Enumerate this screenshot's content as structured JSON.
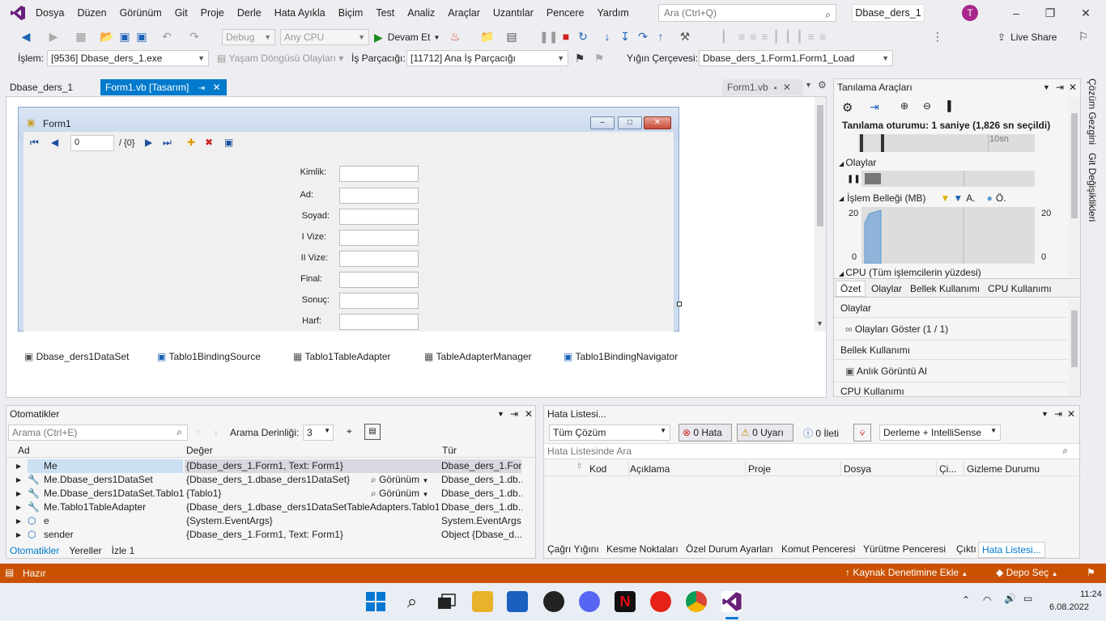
{
  "menubar": {
    "menus": [
      "Dosya",
      "Düzen",
      "Görünüm",
      "Git",
      "Proje",
      "Derle",
      "Hata Ayıkla",
      "Biçim",
      "Test",
      "Analiz",
      "Araçlar",
      "Uzantılar",
      "Pencere",
      "Yardım"
    ],
    "search_placeholder": "Ara (Ctrl+Q)",
    "solution_name": "Dbase_ders_1",
    "avatar_letter": "T",
    "brand_color": "#68217a"
  },
  "toolbar": {
    "config": "Debug",
    "platform": "Any CPU",
    "continue_label": "Devam Et",
    "live_share": "Live Share"
  },
  "debugbar": {
    "process_label": "İşlem:",
    "process_value": "[9536] Dbase_ders_1.exe",
    "lifecycle_label": "Yaşam Döngüsü Olayları",
    "thread_label": "İş Parçacığı:",
    "thread_value": "[11712] Ana İş Parçacığı",
    "stack_label": "Yığın Çerçevesi:",
    "stack_value": "Dbase_ders_1.Form1.Form1_Load"
  },
  "doctabs": {
    "tab1": "Dbase_ders_1",
    "tab2": "Form1.vb [Tasarım]",
    "right_tab": "Form1.vb"
  },
  "form": {
    "title": "Form1",
    "nav_position": "0",
    "nav_count": "/ {0}",
    "fields": [
      "Kimlik:",
      "Ad:",
      "Soyad:",
      "I Vize:",
      "II Vize:",
      "Final:",
      "Sonuç:",
      "Harf:"
    ]
  },
  "tray": {
    "items": [
      "Dbase_ders1DataSet",
      "Tablo1BindingSource",
      "Tablo1TableAdapter",
      "TableAdapterManager",
      "Tablo1BindingNavigator"
    ]
  },
  "diagnostics": {
    "title": "Tanılama Araçları",
    "session": "Tanılama oturumu: 1 saniye (1,826 sn seçildi)",
    "timeline_tick": "10sn",
    "events_label": "Olaylar",
    "memory_label": "İşlem Belleği (MB)",
    "memory_legend_a": "A.",
    "memory_legend_o": "Ö.",
    "memory_max_left": "20",
    "memory_min_left": "0",
    "memory_max_right": "20",
    "memory_min_right": "0",
    "cpu_label": "CPU (Tüm işlemcilerin yüzdesi)",
    "tabs": [
      "Özet",
      "Olaylar",
      "Bellek Kullanımı",
      "CPU Kullanımı"
    ],
    "sec_events": "Olaylar",
    "show_events": "Olayları Göster (1 / 1)",
    "sec_memory": "Bellek Kullanımı",
    "snapshot": "Anlık Görüntü Al",
    "sec_cpu": "CPU Kullanımı"
  },
  "sidebar": {
    "solution_explorer": "Çözüm Gezgini",
    "git_changes": "Git Değişiklikleri"
  },
  "autos": {
    "title": "Otomatikler",
    "search_placeholder": "Arama (Ctrl+E)",
    "depth_label": "Arama Derinliği:",
    "depth_value": "3",
    "columns": [
      "Ad",
      "Değer",
      "Tür"
    ],
    "view_label": "Görünüm",
    "rows": [
      {
        "name": "Me",
        "value": "{Dbase_ders_1.Form1, Text: Form1}",
        "type": "Dbase_ders_1.For..."
      },
      {
        "name": "Me.Dbase_ders1DataSet",
        "value": "{Dbase_ders_1.dbase_ders1DataSet}",
        "type": "Dbase_ders_1.db..."
      },
      {
        "name": "Me.Dbase_ders1DataSet.Tablo1",
        "value": "{Tablo1}",
        "type": "Dbase_ders_1.db..."
      },
      {
        "name": "Me.Tablo1TableAdapter",
        "value": "{Dbase_ders_1.dbase_ders1DataSetTableAdapters.Tablo1T...",
        "type": "Dbase_ders_1.db..."
      },
      {
        "name": "e",
        "value": "{System.EventArgs}",
        "type": "System.EventArgs"
      },
      {
        "name": "sender",
        "value": "{Dbase_ders_1.Form1, Text: Form1}",
        "type": "Object {Dbase_d..."
      }
    ],
    "bottom_tabs": [
      "Otomatikler",
      "Yereller",
      "İzle 1"
    ]
  },
  "errors": {
    "title": "Hata Listesi...",
    "scope": "Tüm Çözüm",
    "errors_btn": "0 Hata",
    "warnings_btn": "0 Uyarı",
    "messages_btn": "0 İleti",
    "build_filter": "Derleme + IntelliSense",
    "search_placeholder": "Hata Listesinde Ara",
    "columns": [
      "Kod",
      "Açıklama",
      "Proje",
      "Dosya",
      "Çi...",
      "Gizleme Durumu"
    ],
    "bottom_tabs": [
      "Çağrı Yığını",
      "Kesme Noktaları",
      "Özel Durum Ayarları",
      "Komut Penceresi",
      "Yürütme Penceresi",
      "Çıktı",
      "Hata Listesi..."
    ]
  },
  "statusbar": {
    "ready": "Hazır",
    "source_control": "Kaynak Denetimine Ekle",
    "repo": "Depo Seç",
    "color": "#ca5100"
  },
  "taskbar": {
    "time": "11:24",
    "date": "6.08.2022"
  }
}
